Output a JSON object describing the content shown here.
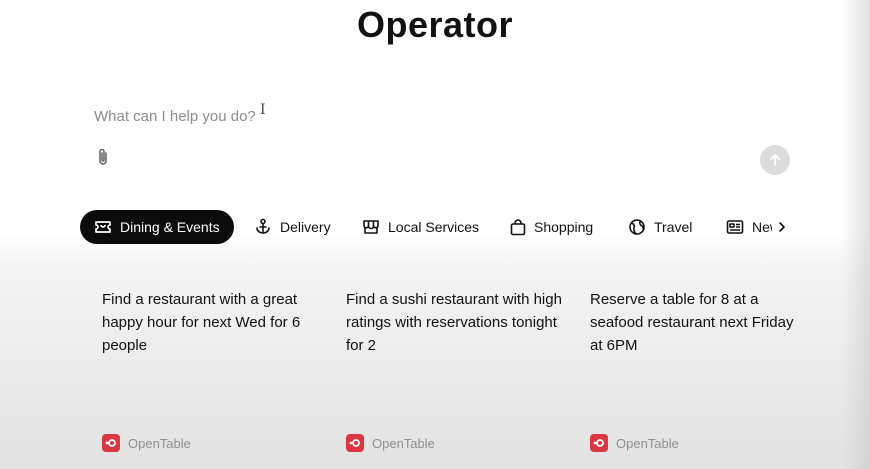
{
  "app": {
    "title": "Operator"
  },
  "composer": {
    "placeholder": "What can I help you do?",
    "cursor_glyph": "I",
    "attach_icon": "paperclip-icon",
    "send_icon": "arrow-up-icon"
  },
  "tabs": [
    {
      "label": "Dining & Events",
      "icon": "ticket-icon",
      "active": true
    },
    {
      "label": "Delivery",
      "icon": "anchor-icon",
      "active": false
    },
    {
      "label": "Local Services",
      "icon": "storefront-icon",
      "active": false
    },
    {
      "label": "Shopping",
      "icon": "shopping-bag-icon",
      "active": false
    },
    {
      "label": "Travel",
      "icon": "globe-icon",
      "active": false
    },
    {
      "label": "News",
      "icon": "newspaper-icon",
      "active": false
    }
  ],
  "tabs_next_icon": "chevron-right-icon",
  "cards": [
    {
      "text": "Find a restaurant with a great happy hour for next Wed for 6 people",
      "source": "OpenTable"
    },
    {
      "text": "Find a sushi restaurant with high ratings with reservations tonight for 2",
      "source": "OpenTable"
    },
    {
      "text": "Reserve a table for 8 at a seafood restaurant next Friday at 6PM",
      "source": "OpenTable"
    }
  ],
  "colors": {
    "active_tab_bg": "#0b0b0b",
    "send_button_bg": "#dcdcdc",
    "opentable_red": "#da3743",
    "muted_text": "#8e8e8e"
  }
}
